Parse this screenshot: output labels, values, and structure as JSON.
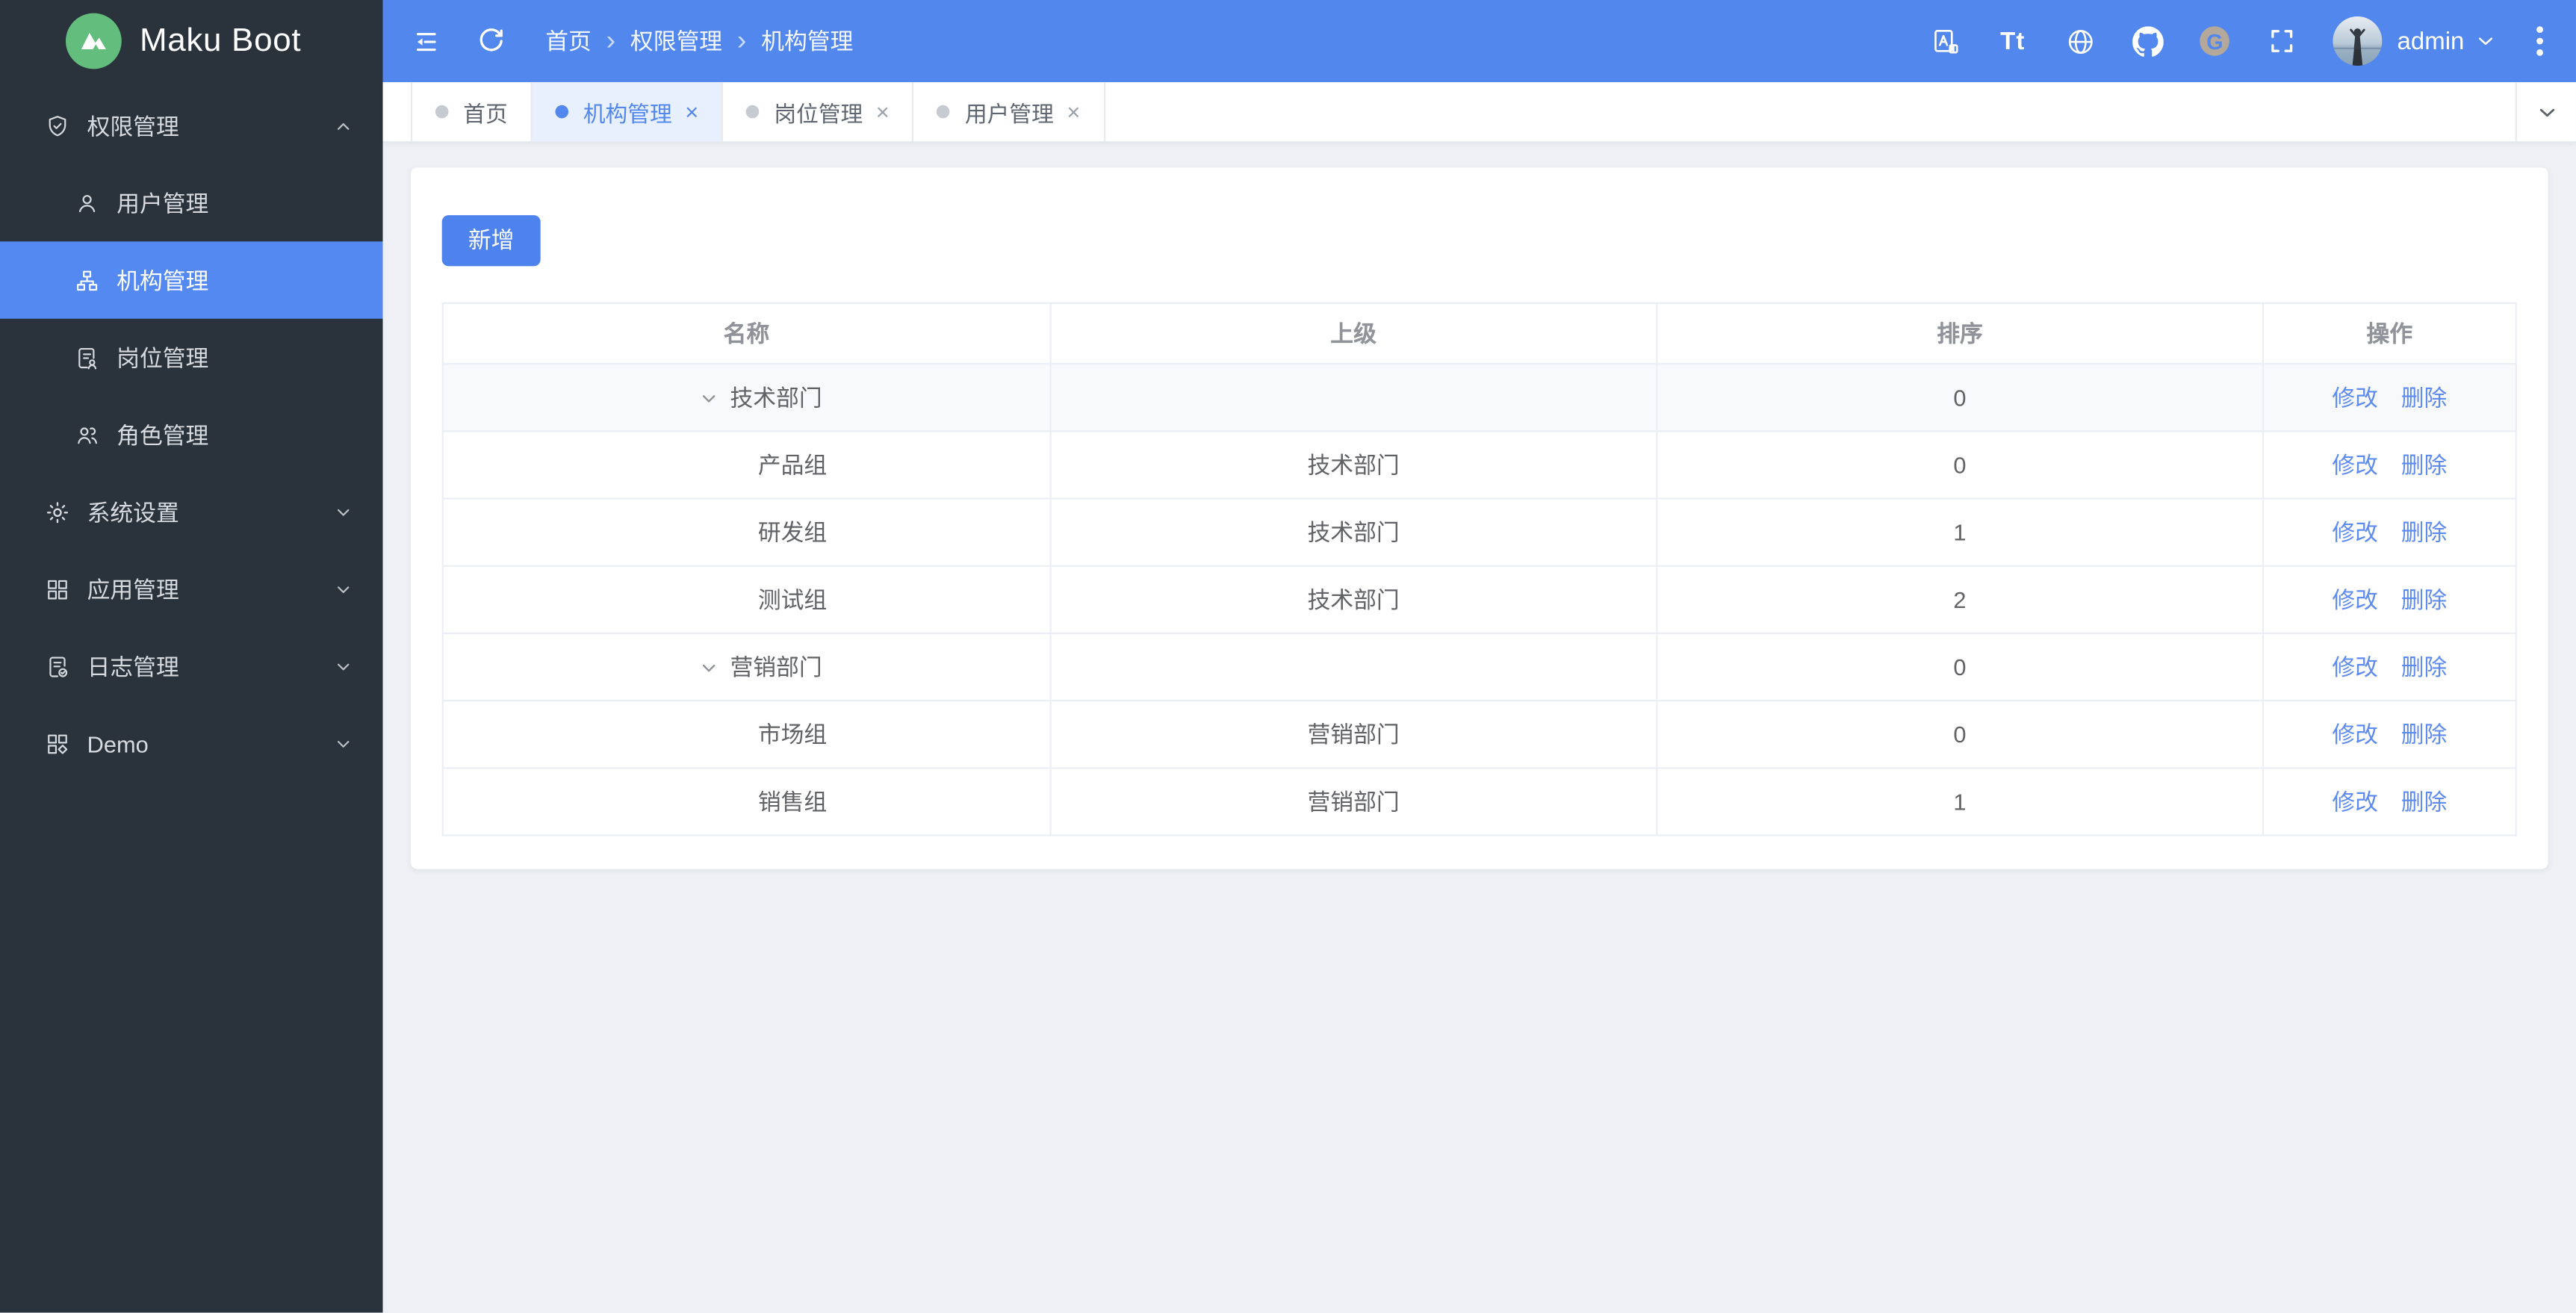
{
  "app": {
    "name": "Maku Boot"
  },
  "colors": {
    "header_blue": "#5287ee",
    "sidebar_dark": "#2a323c",
    "sidebar_active_blue": "#5389f0",
    "logo_green": "#63bd7d",
    "primary_button_blue": "#4e83ee",
    "link_blue": "#5e8bf0",
    "page_background": "#eef0f5",
    "active_tab_background": "#e9f0fd"
  },
  "sidebar": {
    "menu": {
      "perm": {
        "label": "权限管理"
      },
      "user": {
        "label": "用户管理"
      },
      "org": {
        "label": "机构管理"
      },
      "post": {
        "label": "岗位管理"
      },
      "role": {
        "label": "角色管理"
      },
      "sys": {
        "label": "系统设置"
      },
      "apps": {
        "label": "应用管理"
      },
      "log": {
        "label": "日志管理"
      },
      "demo": {
        "label": "Demo"
      }
    }
  },
  "header": {
    "breadcrumb": {
      "home": "首页",
      "separator": "›",
      "section": "权限管理",
      "current": "机构管理"
    },
    "user": {
      "name": "admin"
    }
  },
  "icons": {
    "menu_fold": "menu-fold-with-left-arrow",
    "refresh": "circular-arrow",
    "translate": "page-with-A",
    "font_size_glyph": "Tt",
    "globe": "globe",
    "github": "octocat",
    "gitee_letter": "G",
    "fullscreen": "corner-brackets",
    "close_glyph": "×",
    "tab_dot": "circle-dot",
    "kebab": "vertical-dots"
  },
  "tabs": {
    "home": "首页",
    "org": "机构管理",
    "post": "岗位管理",
    "user": "用户管理"
  },
  "toolbar": {
    "add": "新增"
  },
  "table": {
    "columns": {
      "name": "名称",
      "parent": "上级",
      "sort": "排序",
      "actions": "操作"
    },
    "actions": {
      "edit": "修改",
      "del": "删除"
    },
    "rows": [
      {
        "name": "技术部门",
        "parent": "",
        "sort": "0"
      },
      {
        "name": "产品组",
        "parent": "技术部门",
        "sort": "0"
      },
      {
        "name": "研发组",
        "parent": "技术部门",
        "sort": "1"
      },
      {
        "name": "测试组",
        "parent": "技术部门",
        "sort": "2"
      },
      {
        "name": "营销部门",
        "parent": "",
        "sort": "0"
      },
      {
        "name": "市场组",
        "parent": "营销部门",
        "sort": "0"
      },
      {
        "name": "销售组",
        "parent": "营销部门",
        "sort": "1"
      }
    ]
  }
}
